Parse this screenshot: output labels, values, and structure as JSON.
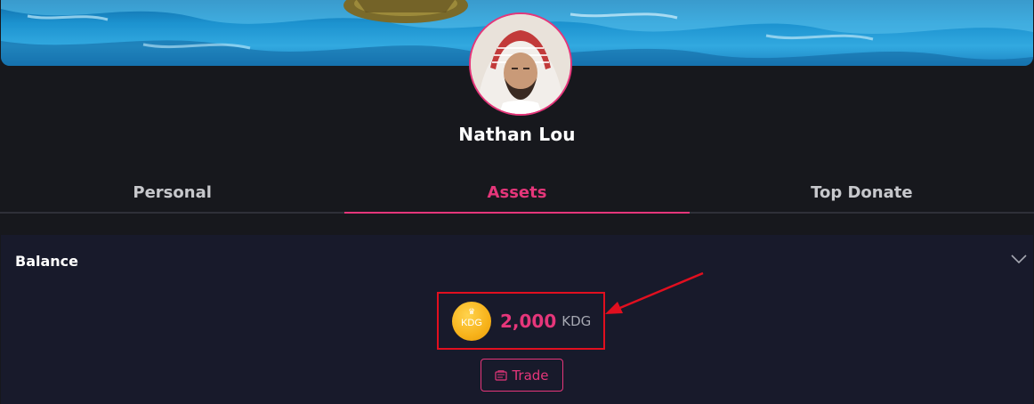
{
  "profile": {
    "name": "Nathan Lou"
  },
  "tabs": [
    {
      "label": "Personal",
      "active": false
    },
    {
      "label": "Assets",
      "active": true
    },
    {
      "label": "Top Donate",
      "active": false
    }
  ],
  "balance": {
    "title": "Balance",
    "coin_badge": "KDG",
    "amount": "2,000",
    "unit": "KDG",
    "trade_label": "Trade"
  },
  "icons": {
    "collapse": "chevron-down-icon",
    "coin": "kdg-coin-icon",
    "trade": "trade-icon"
  },
  "colors": {
    "accent": "#e5367a",
    "background": "#17181d",
    "panel": "#181a2b",
    "highlight": "#e10f1f",
    "coin": "#f7b21a"
  }
}
